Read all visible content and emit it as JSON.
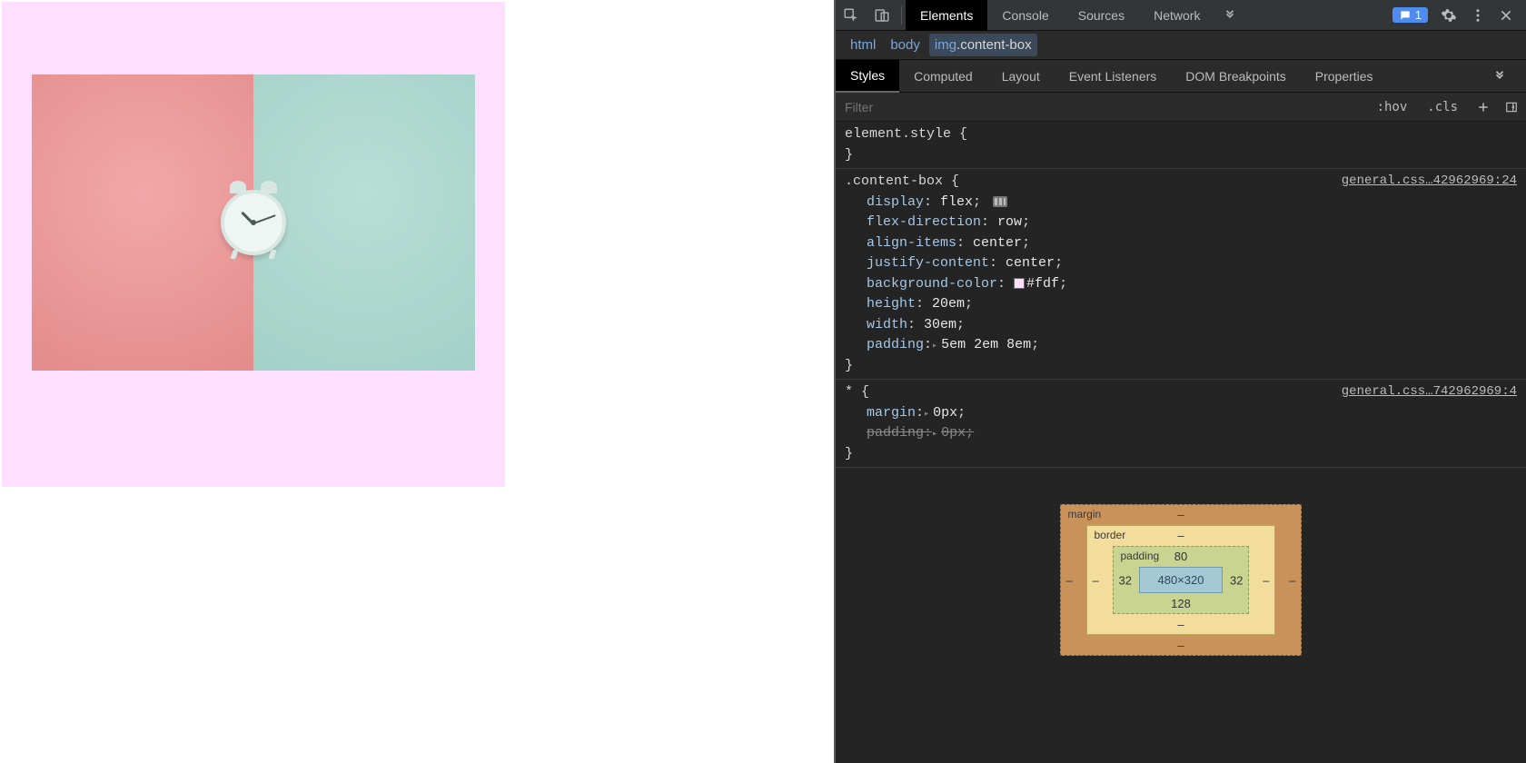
{
  "topbar": {
    "tabs": [
      "Elements",
      "Console",
      "Sources",
      "Network"
    ],
    "active_tab": "Elements",
    "issues_count": "1"
  },
  "breadcrumb": {
    "items": [
      "html",
      "body"
    ],
    "selected_tag": "img",
    "selected_class": ".content-box"
  },
  "subtabs": {
    "items": [
      "Styles",
      "Computed",
      "Layout",
      "Event Listeners",
      "DOM Breakpoints",
      "Properties"
    ],
    "active": "Styles"
  },
  "filter": {
    "placeholder": "Filter",
    "hov": ":hov",
    "cls": ".cls"
  },
  "rules": {
    "element_style": {
      "selector": "element.style",
      "open": "{",
      "close": "}"
    },
    "content_box": {
      "selector": ".content-box",
      "open": "{",
      "close": "}",
      "source": "general.css…42962969:24",
      "decls": [
        {
          "prop": "display",
          "val": "flex",
          "flexicon": true
        },
        {
          "prop": "flex-direction",
          "val": "row"
        },
        {
          "prop": "align-items",
          "val": "center"
        },
        {
          "prop": "justify-content",
          "val": "center"
        },
        {
          "prop": "background-color",
          "val": "#fdf",
          "swatch": "#ffdfff"
        },
        {
          "prop": "height",
          "val": "20em"
        },
        {
          "prop": "width",
          "val": "30em"
        },
        {
          "prop": "padding",
          "val": "5em 2em 8em",
          "expandable": true
        }
      ]
    },
    "star": {
      "selector": "*",
      "open": "{",
      "close": "}",
      "source": "general.css…742962969:4",
      "decls": [
        {
          "prop": "margin",
          "val": "0px",
          "expandable": true
        },
        {
          "prop": "padding",
          "val": "0px",
          "expandable": true,
          "strike": true
        }
      ]
    }
  },
  "boxmodel": {
    "margin_label": "margin",
    "border_label": "border",
    "padding_label": "padding",
    "content": "480×320",
    "dash": "–",
    "padding_top": "80",
    "padding_right": "32",
    "padding_bottom": "128",
    "padding_left": "32"
  }
}
